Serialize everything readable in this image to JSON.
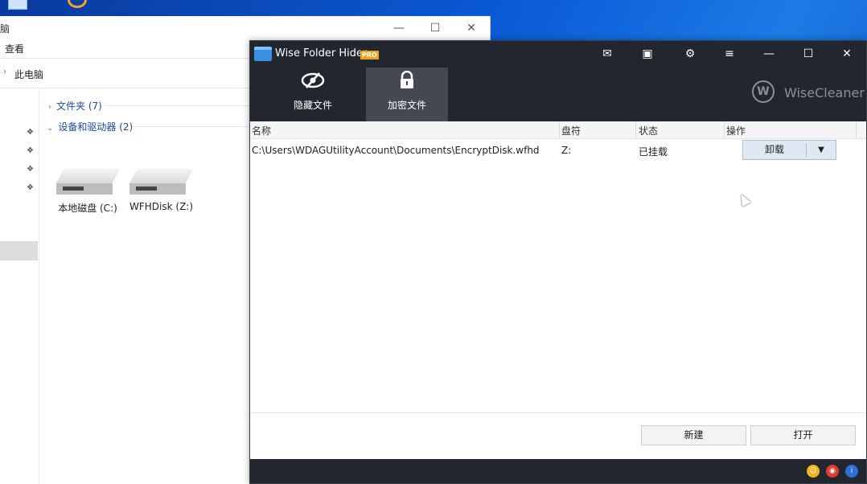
{
  "explorer": {
    "title_fragment": "脑",
    "ribbon_view": "查看",
    "breadcrumb": "此电脑",
    "groups": {
      "folders": "文件夹 (7)",
      "devices": "设备和驱动器 (2)"
    },
    "drives": [
      {
        "label": "本地磁盘 (C:)"
      },
      {
        "label": "WFHDisk (Z:)"
      }
    ]
  },
  "app": {
    "title": "Wise Folder Hider",
    "badge": "PRO",
    "brand": "WiseCleaner",
    "brand_mark": "W",
    "tabs": [
      {
        "label": "隐藏文件",
        "icon": "eye-slash-icon",
        "active": false
      },
      {
        "label": "加密文件",
        "icon": "lock-icon",
        "active": true
      }
    ],
    "table": {
      "columns": [
        "名称",
        "盘符",
        "状态",
        "操作"
      ],
      "rows": [
        {
          "name": "C:\\Users\\WDAGUtilityAccount\\Documents\\EncryptDisk.wfhd",
          "drive": "Z:",
          "status": "已挂载",
          "action": "卸载"
        }
      ]
    },
    "buttons": {
      "new": "新建",
      "open": "打开"
    }
  },
  "colors": {
    "header_bg": "#22272f",
    "active_tab_bg": "#434852",
    "pro_badge": "#f4a21c",
    "action_button_bg": "#dfe9f3"
  }
}
